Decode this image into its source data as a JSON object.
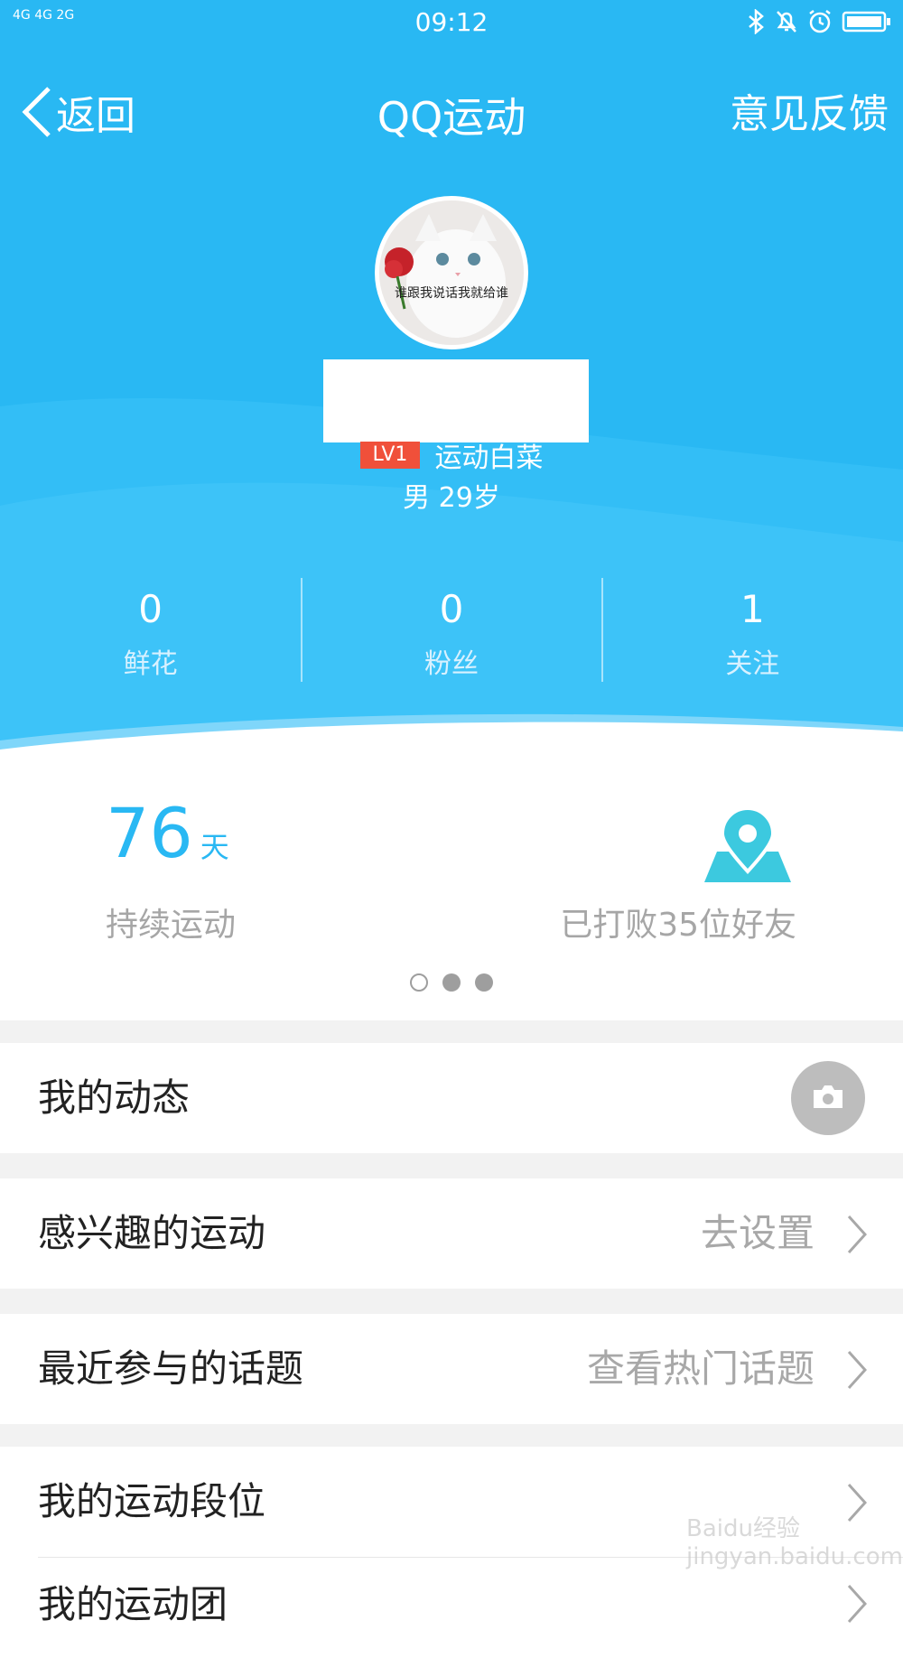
{
  "status_bar": {
    "signal": "4G 4G 2G",
    "time": "09:12"
  },
  "nav": {
    "back_label": "返回",
    "title": "QQ运动",
    "feedback_label": "意见反馈"
  },
  "profile": {
    "avatar_caption": "谁跟我说话我就给谁",
    "level_badge": "LV1",
    "level_title": "运动白菜",
    "gender_age": "男  29岁"
  },
  "stats": [
    {
      "value": "0",
      "label": "鲜花"
    },
    {
      "value": "0",
      "label": "粉丝"
    },
    {
      "value": "1",
      "label": "关注"
    }
  ],
  "summary": {
    "days_value": "76",
    "days_unit": "天",
    "days_label": "持续运动",
    "beat_label": "已打败35位好友",
    "page_count": 3,
    "active_page": 1
  },
  "menu": {
    "my_feed": "我的动态",
    "interests": "感兴趣的运动",
    "interests_hint": "去设置",
    "topics": "最近参与的话题",
    "topics_hint": "查看热门话题",
    "rank": "我的运动段位",
    "group": "我的运动团"
  },
  "watermark": "Baidu经验 jingyan.baidu.com",
  "colors": {
    "primary": "#29b8f3",
    "level_badge": "#f0503a",
    "pin": "#3cc9df"
  }
}
